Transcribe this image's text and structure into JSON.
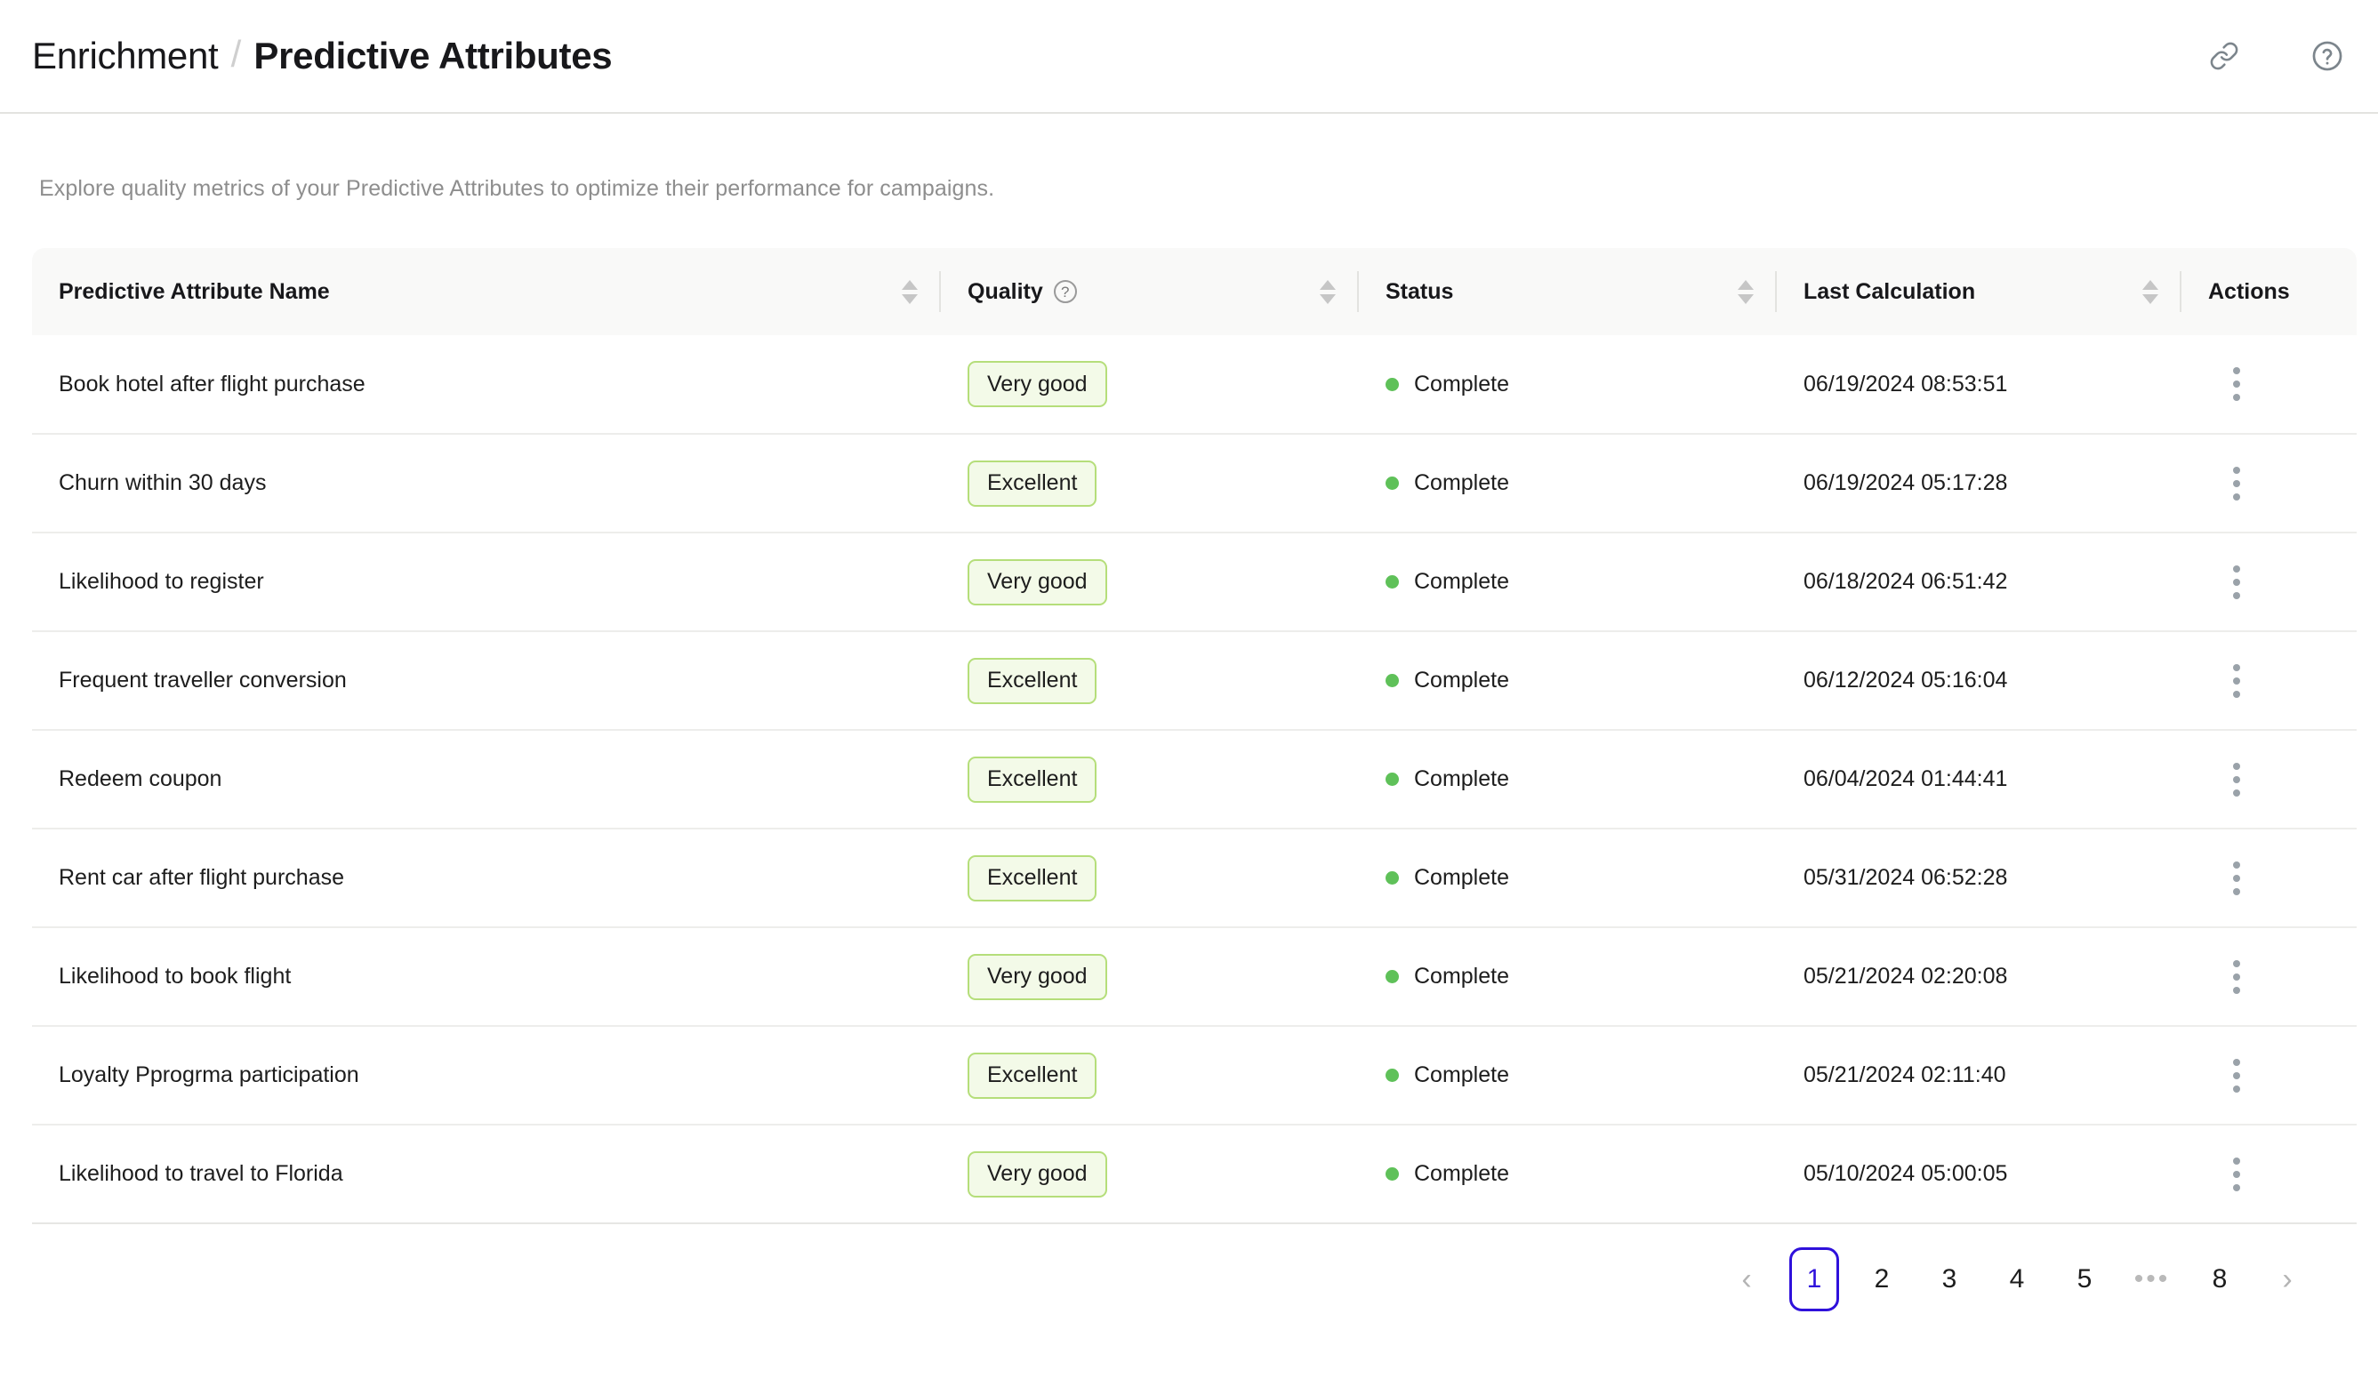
{
  "header": {
    "breadcrumb_root": "Enrichment",
    "breadcrumb_separator": "/",
    "breadcrumb_current": "Predictive Attributes",
    "link_icon": "link-icon",
    "help_icon": "help-circle-icon"
  },
  "page": {
    "subtitle": "Explore quality metrics of your Predictive Attributes to optimize their performance for campaigns."
  },
  "table": {
    "columns": [
      {
        "label": "Predictive Attribute Name",
        "sortable": true,
        "has_help": false
      },
      {
        "label": "Quality",
        "sortable": true,
        "has_help": true
      },
      {
        "label": "Status",
        "sortable": true,
        "has_help": false
      },
      {
        "label": "Last Calculation",
        "sortable": true,
        "has_help": false
      },
      {
        "label": "Actions",
        "sortable": false,
        "has_help": false
      }
    ],
    "rows": [
      {
        "name": "Book hotel after flight purchase",
        "quality": "Very good",
        "status": "Complete",
        "last_calculation": "06/19/2024 08:53:51"
      },
      {
        "name": "Churn within 30 days",
        "quality": "Excellent",
        "status": "Complete",
        "last_calculation": "06/19/2024 05:17:28"
      },
      {
        "name": "Likelihood to register",
        "quality": "Very good",
        "status": "Complete",
        "last_calculation": "06/18/2024 06:51:42"
      },
      {
        "name": "Frequent traveller conversion",
        "quality": "Excellent",
        "status": "Complete",
        "last_calculation": "06/12/2024 05:16:04"
      },
      {
        "name": "Redeem coupon",
        "quality": "Excellent",
        "status": "Complete",
        "last_calculation": "06/04/2024 01:44:41"
      },
      {
        "name": "Rent car after flight purchase",
        "quality": "Excellent",
        "status": "Complete",
        "last_calculation": "05/31/2024 06:52:28"
      },
      {
        "name": "Likelihood to book flight",
        "quality": "Very good",
        "status": "Complete",
        "last_calculation": "05/21/2024 02:20:08"
      },
      {
        "name": "Loyalty Pprogrma participation",
        "quality": "Excellent",
        "status": "Complete",
        "last_calculation": "05/21/2024 02:11:40"
      },
      {
        "name": "Likelihood to travel to Florida",
        "quality": "Very good",
        "status": "Complete",
        "last_calculation": "05/10/2024 05:00:05"
      }
    ]
  },
  "pagination": {
    "prev_label": "‹",
    "next_label": "›",
    "pages": [
      "1",
      "2",
      "3",
      "4",
      "5"
    ],
    "ellipsis": "•••",
    "last_page": "8",
    "active_page": "1"
  },
  "colors": {
    "accent": "#2F11DB",
    "status_dot": "#5FC159",
    "badge_bg": "#F3FAE8",
    "badge_border": "#B5DE7A",
    "header_bg": "#F9F9F8",
    "muted_text": "#8E8E8E"
  }
}
